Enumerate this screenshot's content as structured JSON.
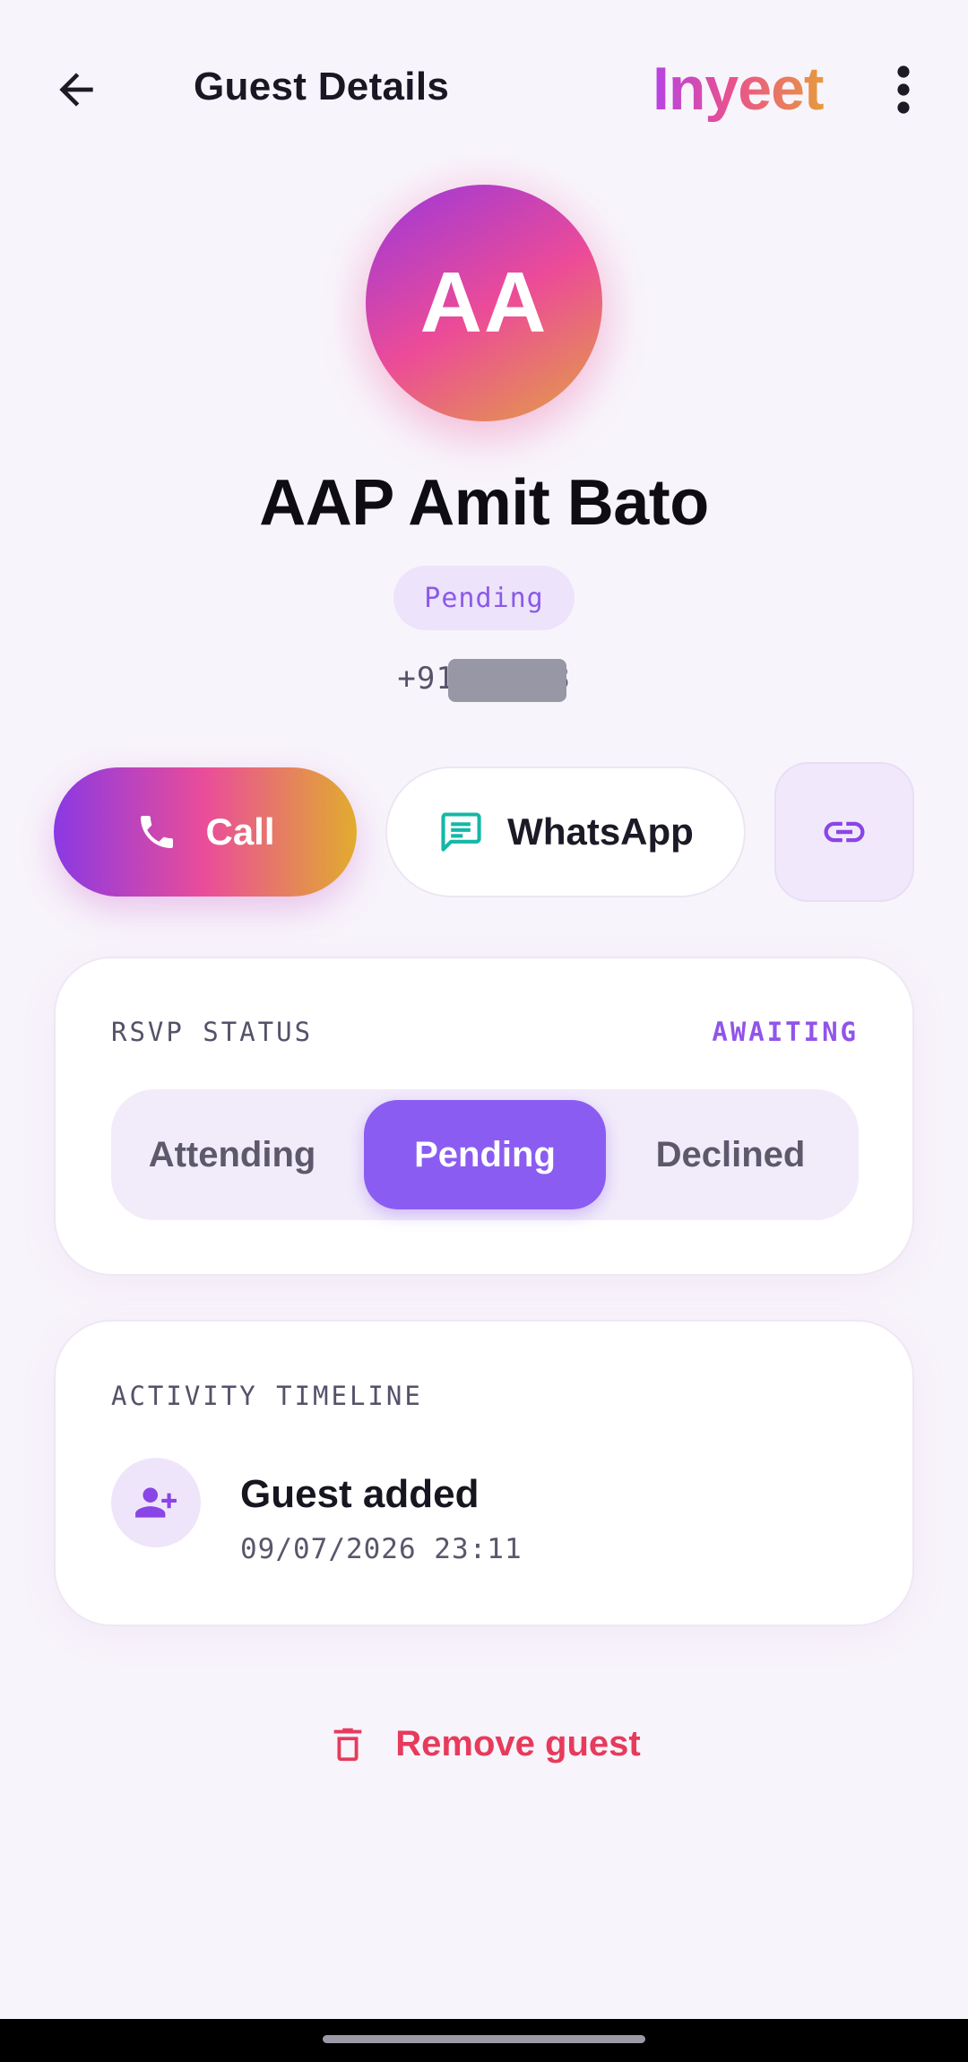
{
  "header": {
    "title": "Guest Details",
    "brand": "Inyeet",
    "back_icon": "arrow-left-icon",
    "more_icon": "more-vertical-icon"
  },
  "guest": {
    "initials": "AA",
    "name": "AAP Amit Bato",
    "status_badge": "Pending",
    "phone": "+9198      388"
  },
  "actions": {
    "call_label": "Call",
    "whatsapp_label": "WhatsApp",
    "link_icon": "link-icon"
  },
  "rsvp": {
    "label": "RSVP STATUS",
    "state": "AWAITING",
    "options": [
      "Attending",
      "Pending",
      "Declined"
    ],
    "selected": "Pending"
  },
  "activity": {
    "label": "ACTIVITY TIMELINE",
    "items": [
      {
        "title": "Guest added",
        "time": "09/07/2026 23:11",
        "icon": "person-add-icon"
      }
    ]
  },
  "remove": {
    "label": "Remove guest"
  },
  "colors": {
    "accent": "#8b5cf2",
    "danger": "#e63b5c",
    "whatsapp_icon": "#14b8a6",
    "background": "#f8f4fb"
  }
}
